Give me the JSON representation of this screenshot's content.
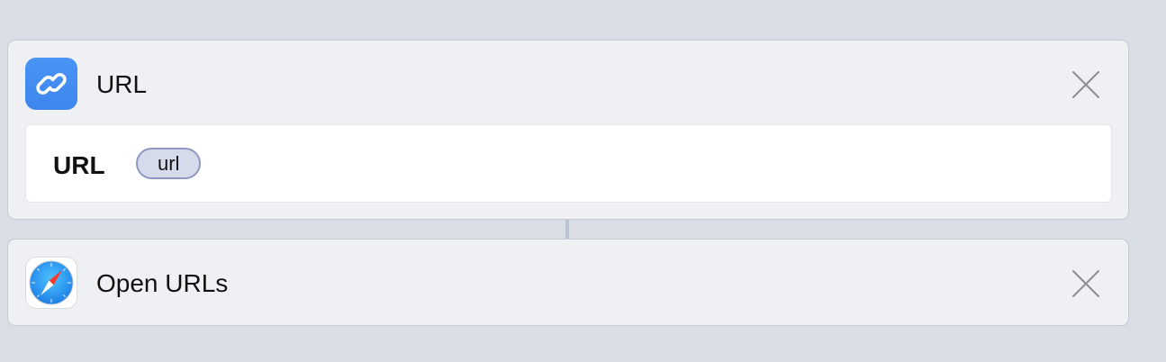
{
  "actions": [
    {
      "title": "URL",
      "icon": "link-icon",
      "icon_color": "#4390f2",
      "parameter": {
        "label": "URL",
        "token": "url"
      }
    },
    {
      "title": "Open URLs",
      "icon": "safari-compass-icon"
    }
  ],
  "colors": {
    "background": "#d9dde5",
    "card": "#eff0f4",
    "token_fill": "#d6dbeb",
    "token_border": "#8e97c2",
    "connector": "#b9c3d1"
  }
}
